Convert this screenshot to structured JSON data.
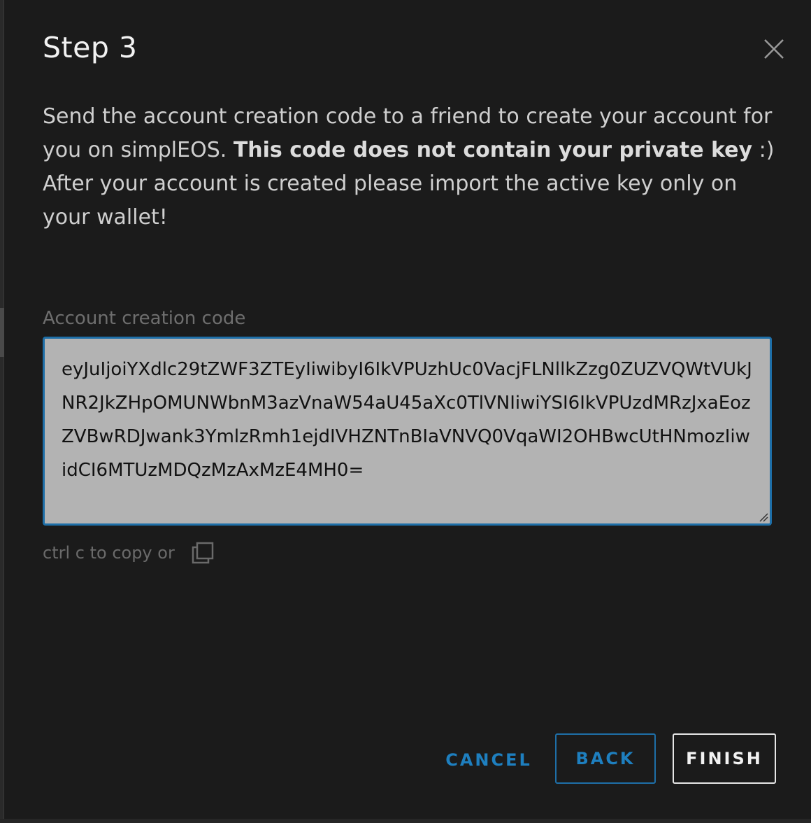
{
  "dialog": {
    "title": "Step 3",
    "description_part1": "Send the account creation code to a friend to create your account for you on simplEOS. ",
    "description_bold": "This code does not contain your private key",
    "description_part2": " :)",
    "description_line2": "After your account is created please import the active key only on your wallet!",
    "field_label": "Account creation code",
    "code_value": "eyJuIjoiYXdlc29tZWF3ZTEyIiwibyI6IkVPUzhUc0VacjFLNllkZzg0ZUZVQWtVUkJNR2JkZHpOMUNWbnM3azVnaW54aU45aXc0TlVNIiwiYSI6IkVPUzdMRzJxaEozZVBwRDJwank3YmlzRmh1ejdIVHZNTnBIaVNVQ0VqaWI2OHBwcUtHNmozIiwidCI6MTUzMDQzMzAxMzE4MH0=",
    "copy_hint": "ctrl c to copy or",
    "icons": {
      "close": "close-icon",
      "copy": "copy-icon",
      "grip": "resize-grip-icon"
    }
  },
  "actions": {
    "cancel_label": "CANCEL",
    "back_label": "BACK",
    "finish_label": "FINISH"
  },
  "colors": {
    "background": "#1b1b1b",
    "accent": "#1e7fbf",
    "code_background": "#b3b3b3"
  }
}
